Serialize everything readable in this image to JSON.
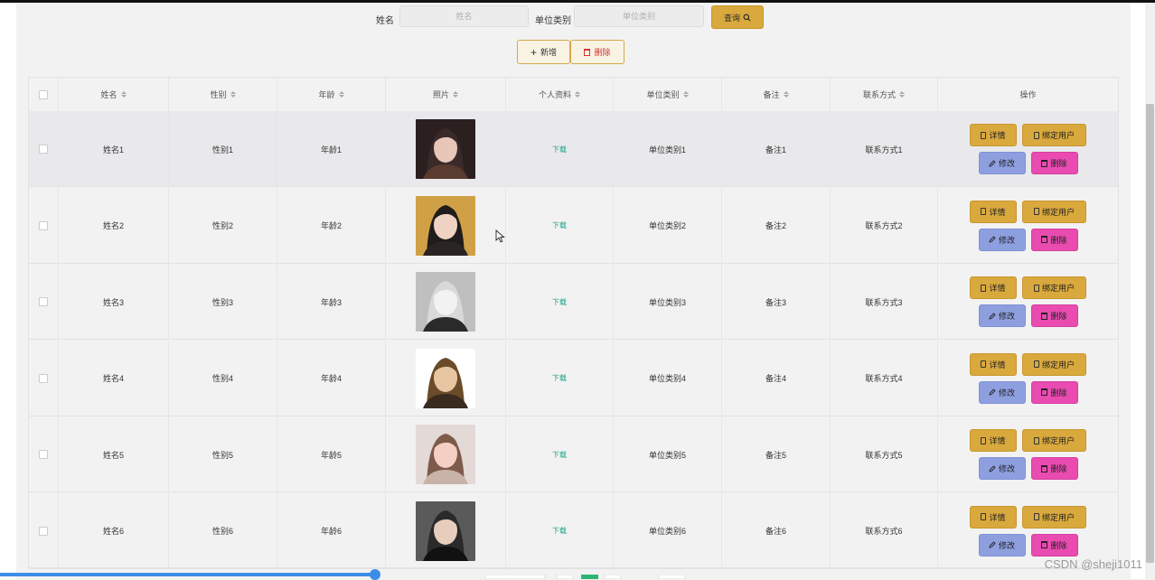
{
  "search": {
    "name_label": "姓名",
    "name_placeholder": "姓名",
    "unit_label": "单位类别",
    "unit_placeholder": "单位类别",
    "query_button": "查询"
  },
  "toolbar": {
    "add_button": "新增",
    "delete_button": "删除"
  },
  "table": {
    "columns": [
      "姓名",
      "性别",
      "年龄",
      "照片",
      "个人资料",
      "单位类别",
      "备注",
      "联系方式",
      "操作"
    ],
    "download_label": "下载",
    "actions": {
      "detail": "详情",
      "bind_user": "绑定用户",
      "edit": "修改",
      "delete": "删除"
    },
    "rows": [
      {
        "name": "姓名1",
        "gender": "性别1",
        "age": "年龄1",
        "unit": "单位类别1",
        "note": "备注1",
        "contact": "联系方式1"
      },
      {
        "name": "姓名2",
        "gender": "性别2",
        "age": "年龄2",
        "unit": "单位类别2",
        "note": "备注2",
        "contact": "联系方式2"
      },
      {
        "name": "姓名3",
        "gender": "性别3",
        "age": "年龄3",
        "unit": "单位类别3",
        "note": "备注3",
        "contact": "联系方式3"
      },
      {
        "name": "姓名4",
        "gender": "性别4",
        "age": "年龄4",
        "unit": "单位类别4",
        "note": "备注4",
        "contact": "联系方式4"
      },
      {
        "name": "姓名5",
        "gender": "性别5",
        "age": "年龄5",
        "unit": "单位类别5",
        "note": "备注5",
        "contact": "联系方式5"
      },
      {
        "name": "姓名6",
        "gender": "性别6",
        "age": "年龄6",
        "unit": "单位类别6",
        "note": "备注6",
        "contact": "联系方式6"
      }
    ]
  },
  "watermark": "CSDN @sheji1011",
  "colors": {
    "accent_gold": "#d9a93e",
    "edit_blue": "#8e9fe0",
    "delete_pink": "#e94bb0",
    "link_green": "#1aa086",
    "progress_blue": "#3a8ee6"
  }
}
